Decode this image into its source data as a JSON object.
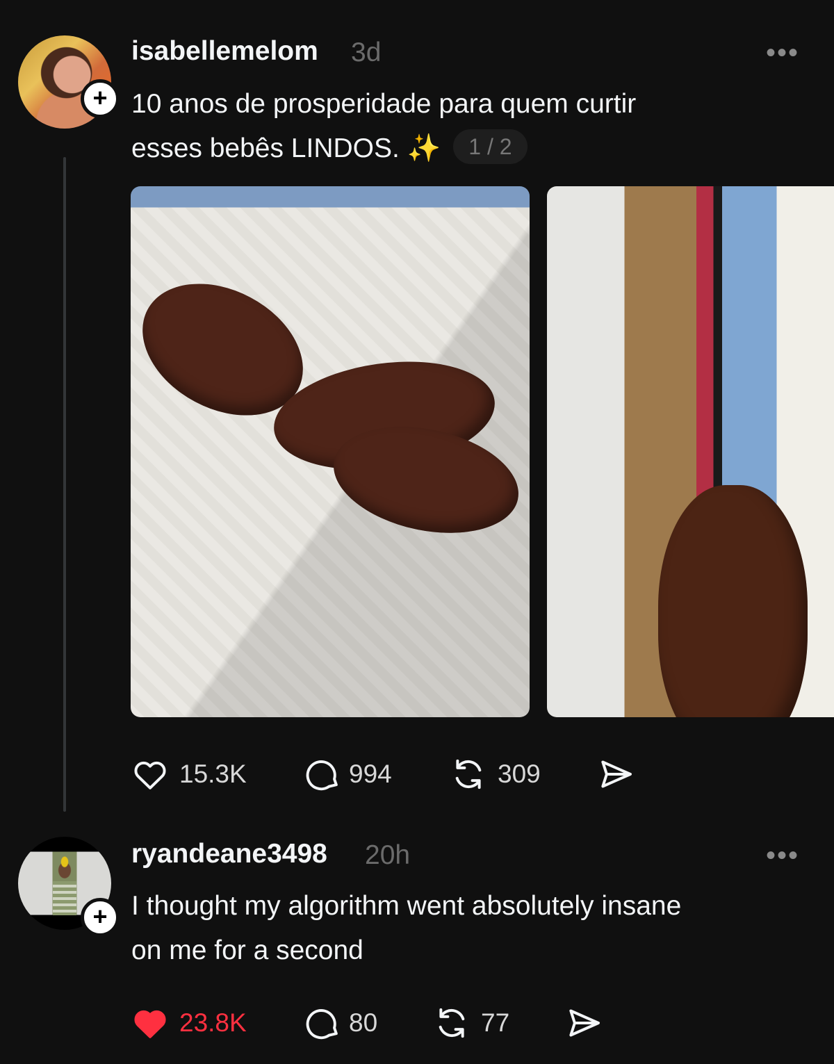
{
  "post": {
    "username": "isabellemelom",
    "time": "3d",
    "caption_line1": "10 anos de prosperidade para quem curtir",
    "caption_line2": "esses bebês LINDOS.",
    "sparkles": "✨",
    "pager": "1 / 2",
    "more": "•••",
    "follow": "+",
    "likes": "15.3K",
    "comments": "994",
    "reposts": "309",
    "icons": [
      "heart-outline-icon",
      "comment-icon",
      "repost-icon",
      "share-icon"
    ]
  },
  "reply": {
    "username": "ryandeane3498",
    "time": "20h",
    "caption_line1": "I thought my algorithm went absolutely insane",
    "caption_line2": "on me for a second",
    "more": "•••",
    "follow": "+",
    "likes": "23.8K",
    "comments": "80",
    "reposts": "77",
    "liked": true,
    "icons": [
      "heart-filled-icon",
      "comment-icon",
      "repost-icon",
      "share-icon"
    ]
  },
  "colors": {
    "background": "#101010",
    "text": "#f3f5f7",
    "muted": "#6b6b6b",
    "like_red": "#ff3040"
  }
}
